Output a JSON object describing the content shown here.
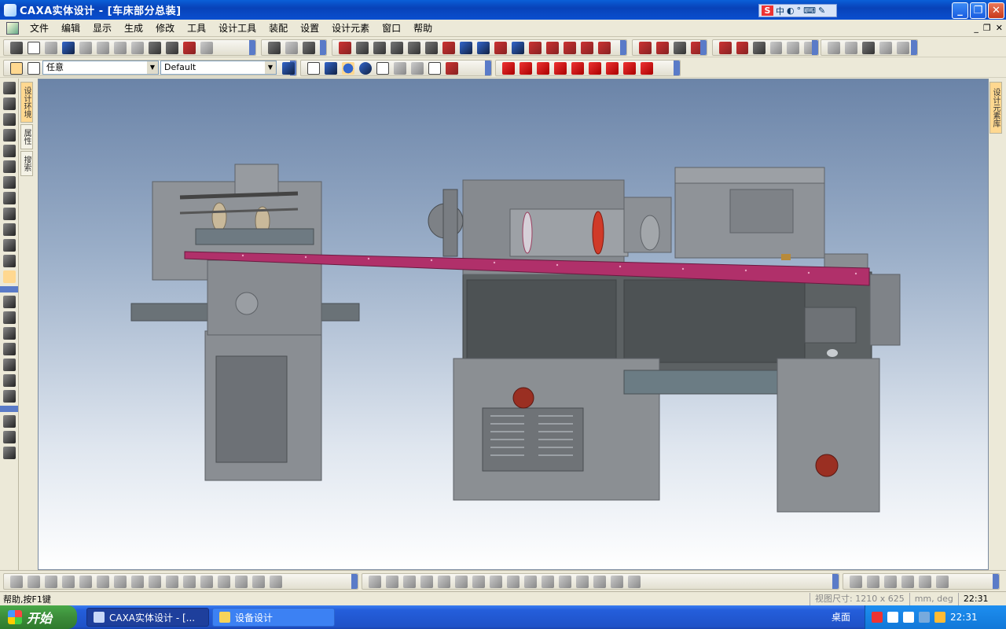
{
  "window": {
    "title": "CAXA实体设计 - [车床部分总装]"
  },
  "ime": {
    "label": "中"
  },
  "menu": {
    "items": [
      "文件",
      "编辑",
      "显示",
      "生成",
      "修改",
      "工具",
      "设计工具",
      "装配",
      "设置",
      "设计元素",
      "窗口",
      "帮助"
    ]
  },
  "toolbar": {
    "selection_filter": "任意",
    "render_style": "Default"
  },
  "side_tabs": {
    "left": [
      "设计环境",
      "属性",
      "搜索"
    ],
    "right": [
      "设计元素库"
    ]
  },
  "statusbar": {
    "help": "帮助,按F1键",
    "view_size": "视图尺寸: 1210 x 625",
    "units": "mm, deg",
    "clock": "22:31"
  },
  "taskbar": {
    "start": "开始",
    "tasks": [
      "CAXA实体设计 - [...",
      "设备设计"
    ],
    "desktop": "桌面",
    "time": "22:31"
  },
  "colors": {
    "titlebar": "#0842b8",
    "machine_gray": "#7d8288",
    "rail_magenta": "#b0306a",
    "accent_red": "#a0281c"
  }
}
